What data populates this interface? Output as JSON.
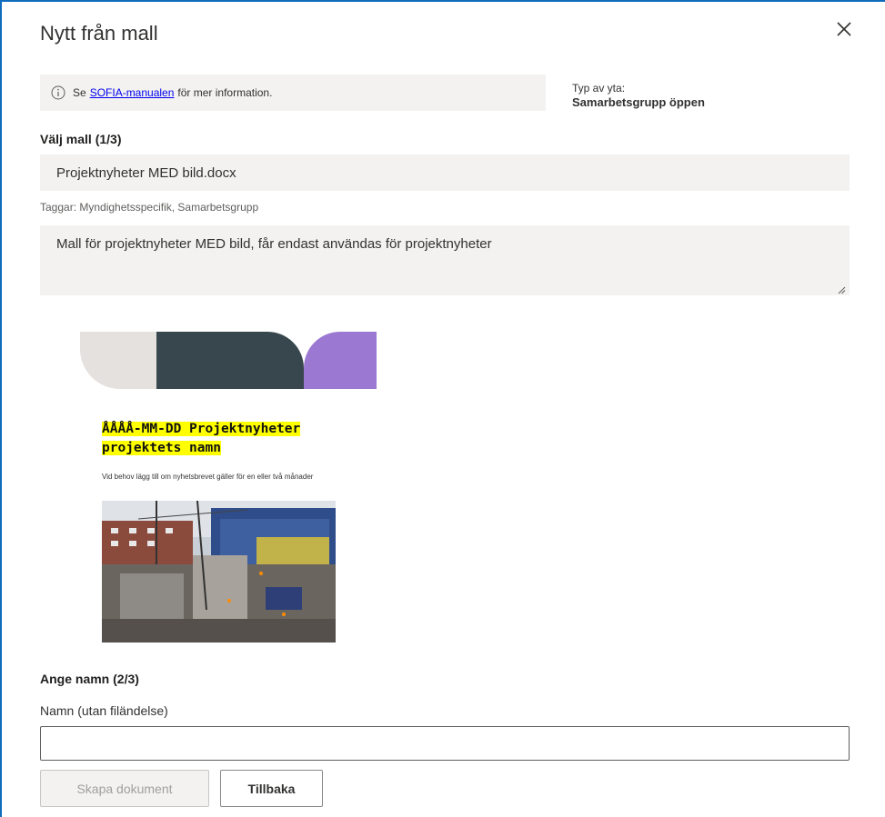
{
  "dialog": {
    "title": "Nytt från mall",
    "close_icon": "close-icon"
  },
  "info": {
    "icon": "info-icon",
    "prefix": "Se",
    "link_text": "SOFIA-manualen",
    "suffix": "för mer information."
  },
  "area_type": {
    "label": "Typ av yta:",
    "value": "Samarbetsgrupp öppen"
  },
  "step1": {
    "heading": "Välj mall (1/3)",
    "selected_template": "Projektnyheter MED bild.docx",
    "tags": "Taggar: Myndighetsspecifik, Samarbetsgrupp",
    "description": "Mall för projektnyheter MED bild, får endast användas för projektnyheter"
  },
  "preview": {
    "title_line1": "ÅÅÅÅ-MM-DD Projektnyheter",
    "title_line2": "projektets namn",
    "subtitle": "Vid behov lägg till om nyhetsbrevet gäller för en eller två månader",
    "colors": {
      "light": "#e5e1df",
      "dark": "#37474d",
      "purple": "#9b78d2",
      "highlight": "#ffff00"
    }
  },
  "step2": {
    "heading": "Ange namn (2/3)",
    "field_label": "Namn (utan filändelse)",
    "value": "",
    "placeholder": ""
  },
  "buttons": {
    "create": "Skapa dokument",
    "back": "Tillbaka"
  },
  "colors": {
    "accent_border": "#0f6cbd",
    "field_bg": "#f3f2f1",
    "link": "#0000ee"
  }
}
